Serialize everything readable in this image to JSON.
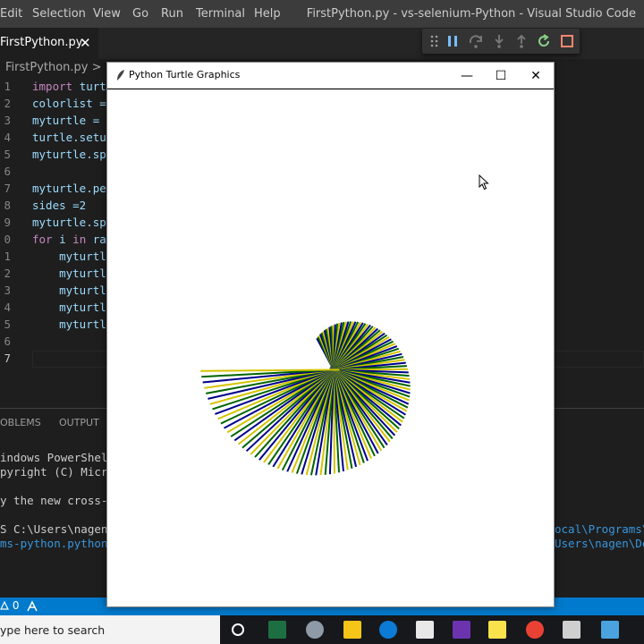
{
  "menubar": {
    "items": [
      "Edit",
      "Selection",
      "View",
      "Go",
      "Run",
      "Terminal",
      "Help"
    ],
    "window_title": "FirstPython.py - vs-selenium-Python - Visual Studio Code"
  },
  "tab": {
    "label": "FirstPython.py",
    "close": "✕"
  },
  "breadcrumb": "FirstPython.py > ...",
  "editor": {
    "lines": [
      {
        "n": "1",
        "code": "import turtle"
      },
      {
        "n": "2",
        "code": "colorlist ="
      },
      {
        "n": "3",
        "code": "myturtle ="
      },
      {
        "n": "4",
        "code": "turtle.setu"
      },
      {
        "n": "5",
        "code": "myturtle.sp"
      },
      {
        "n": "6",
        "code": ""
      },
      {
        "n": "7",
        "code": "myturtle.pe"
      },
      {
        "n": "8",
        "code": "sides =2"
      },
      {
        "n": "9",
        "code": "myturtle.sp"
      },
      {
        "n": "0",
        "code": "for i in ra"
      },
      {
        "n": "1",
        "code": "    myturtl"
      },
      {
        "n": "2",
        "code": "    myturtl"
      },
      {
        "n": "3",
        "code": "    myturtl"
      },
      {
        "n": "4",
        "code": "    myturtl"
      },
      {
        "n": "5",
        "code": "    myturtl"
      },
      {
        "n": "6",
        "code": ""
      },
      {
        "n": "7",
        "code": ""
      }
    ]
  },
  "panel": {
    "tabs": [
      "OBLEMS",
      "OUTPUT"
    ],
    "terminal_lines": [
      "indows PowerShell",
      "pyright (C) Micr",
      "",
      "y the new cross-",
      "",
      "S C:\\Users\\nagen\\"
    ],
    "terminal_link": "ms-python.python",
    "terminal_right_1": "ocal\\Programs\\",
    "terminal_right_2": "Users\\nagen\\De"
  },
  "statusbar": {
    "problems": "0"
  },
  "taskbar": {
    "search_placeholder": "ype here to search"
  },
  "turtle_window": {
    "title": "Python Turtle Graphics",
    "minimize": "—",
    "maximize": "☐",
    "close": "✕"
  },
  "turtle_drawing": {
    "colors": [
      "#00008b",
      "#006400",
      "#d4c400"
    ],
    "pen_stroke_colors_note": "blue, green, yellow repeating"
  },
  "colors": {
    "accent": "#007acc",
    "editor_bg": "#1e1e1e",
    "keyword": "#c586c0",
    "variable": "#9cdcfe"
  }
}
